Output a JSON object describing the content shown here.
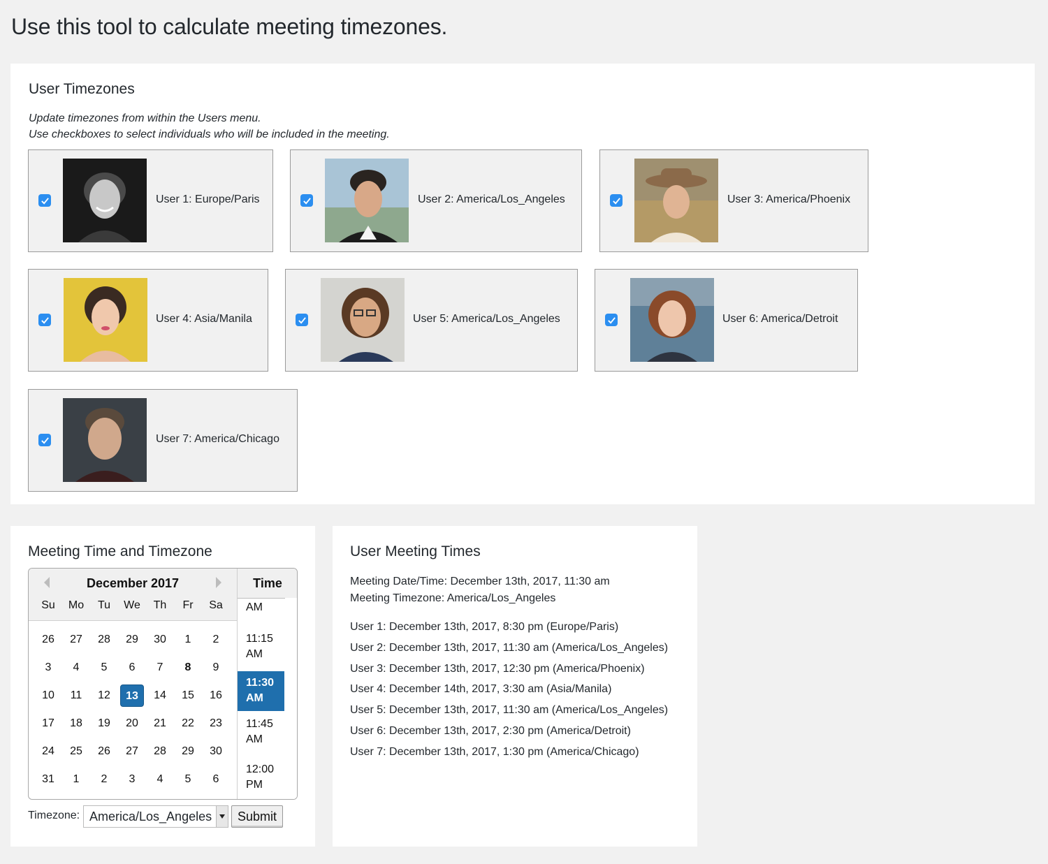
{
  "page": {
    "title": "Use this tool to calculate meeting timezones."
  },
  "user_timezones": {
    "heading": "User Timezones",
    "notes": [
      "Update timezones from within the Users menu.",
      "Use checkboxes to select individuals who will be included in the meeting."
    ],
    "users": [
      {
        "label": "User 1: Europe/Paris",
        "checked": true,
        "avatar": "portrait-man-curly-hair-bw"
      },
      {
        "label": "User 2: America/Los_Angeles",
        "checked": true,
        "avatar": "portrait-man-styled-hair"
      },
      {
        "label": "User 3: America/Phoenix",
        "checked": true,
        "avatar": "portrait-woman-hat"
      },
      {
        "label": "User 4: Asia/Manila",
        "checked": true,
        "avatar": "portrait-woman-yellow-bg"
      },
      {
        "label": "User 5: America/Los_Angeles",
        "checked": true,
        "avatar": "portrait-woman-glasses"
      },
      {
        "label": "User 6: America/Detroit",
        "checked": true,
        "avatar": "portrait-woman-red-hair"
      },
      {
        "label": "User 7: America/Chicago",
        "checked": true,
        "avatar": "portrait-man-dark-bg"
      }
    ]
  },
  "meeting": {
    "heading": "Meeting Time and Timezone",
    "calendar": {
      "month_label": "December 2017",
      "weekdays": [
        "Su",
        "Mo",
        "Tu",
        "We",
        "Th",
        "Fr",
        "Sa"
      ],
      "weeks": [
        [
          "26",
          "27",
          "28",
          "29",
          "30",
          "1",
          "2"
        ],
        [
          "3",
          "4",
          "5",
          "6",
          "7",
          "8",
          "9"
        ],
        [
          "10",
          "11",
          "12",
          "13",
          "14",
          "15",
          "16"
        ],
        [
          "17",
          "18",
          "19",
          "20",
          "21",
          "22",
          "23"
        ],
        [
          "24",
          "25",
          "26",
          "27",
          "28",
          "29",
          "30"
        ],
        [
          "31",
          "1",
          "2",
          "3",
          "4",
          "5",
          "6"
        ]
      ],
      "selected_day": "13",
      "bold_day": "8"
    },
    "time_list": {
      "heading": "Time",
      "items": [
        {
          "line1": "AM",
          "line2": ""
        },
        {
          "line1": "11:15",
          "line2": "AM"
        },
        {
          "line1": "11:30",
          "line2": "AM"
        },
        {
          "line1": "11:45",
          "line2": "AM"
        },
        {
          "line1": "12:00",
          "line2": "PM"
        }
      ],
      "selected": "11:30 AM"
    },
    "timezone_label": "Timezone:",
    "timezone_value": "America/Los_Angeles",
    "submit_label": "Submit"
  },
  "meeting_times": {
    "heading": "User Meeting Times",
    "date_time": "Meeting Date/Time: December 13th, 2017, 11:30 am",
    "timezone": "Meeting Timezone: America/Los_Angeles",
    "users": [
      "User 1: December 13th, 2017, 8:30 pm (Europe/Paris)",
      "User 2: December 13th, 2017, 11:30 am (America/Los_Angeles)",
      "User 3: December 13th, 2017, 12:30 pm (America/Phoenix)",
      "User 4: December 14th, 2017, 3:30 am (Asia/Manila)",
      "User 5: December 13th, 2017, 11:30 am (America/Los_Angeles)",
      "User 6: December 13th, 2017, 2:30 pm (America/Detroit)",
      "User 7: December 13th, 2017, 1:30 pm (America/Chicago)"
    ]
  },
  "colors": {
    "background": "#f1f1f1",
    "panel": "#ffffff",
    "checkbox": "#2b8ef0",
    "selected": "#1f6fad"
  }
}
